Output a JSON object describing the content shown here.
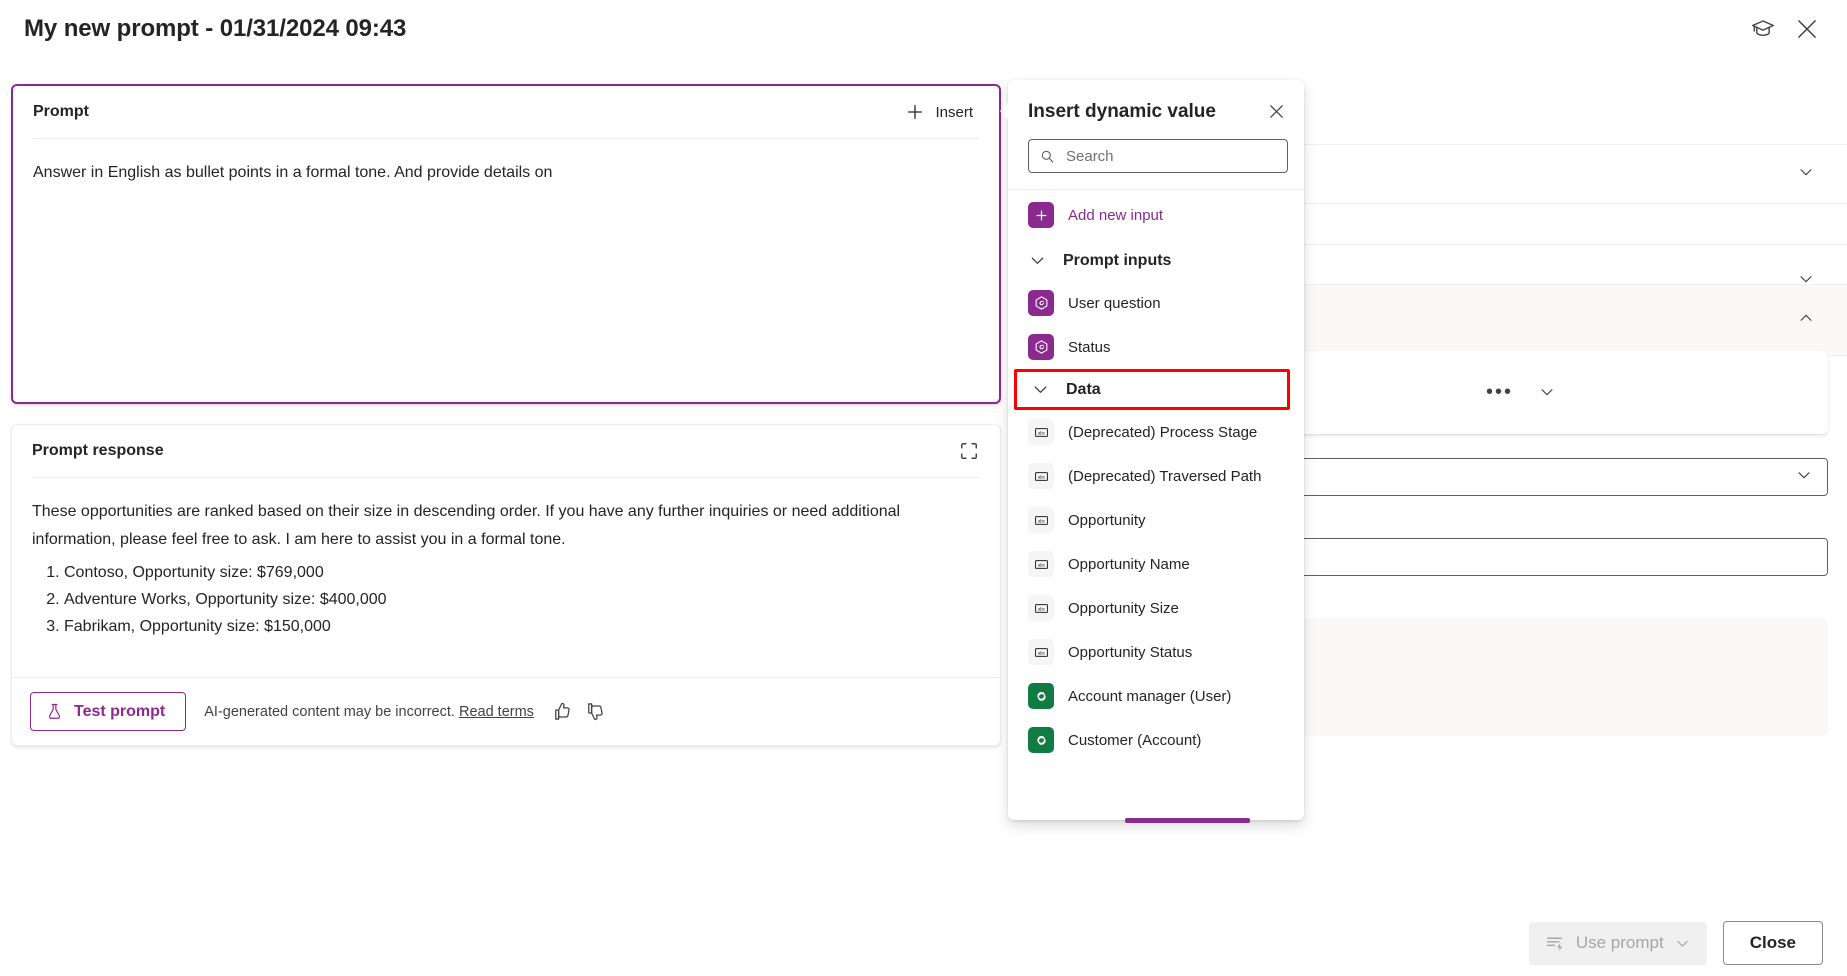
{
  "titlebar": {
    "title": "My new prompt - 01/31/2024 09:43",
    "learn_icon": "graduation-cap-icon",
    "close_icon": "close-icon"
  },
  "prompt_card": {
    "label": "Prompt",
    "insert_label": "Insert",
    "insert_icon": "plus-icon",
    "text": "Answer in English as bullet points in a formal tone. And provide details on"
  },
  "response_card": {
    "label": "Prompt response",
    "expand_icon": "fullscreen-icon",
    "paragraph": "These opportunities are ranked based on their size in descending order. If you have any further inquiries or need additional information, please feel free to ask. I am here to assist you in a formal tone.",
    "items": [
      "Contoso, Opportunity size: $769,000",
      "Adventure Works, Opportunity size: $400,000",
      "Fabrikam, Opportunity size: $150,000"
    ],
    "test_button": "Test prompt",
    "test_icon": "beaker-icon",
    "disclaimer": "AI-generated content may be incorrect.",
    "read_terms": "Read terms",
    "thumbs_up_icon": "thumbs-up-icon",
    "thumbs_down_icon": "thumbs-down-icon"
  },
  "flyout": {
    "title": "Insert dynamic value",
    "close_icon": "close-icon",
    "search": {
      "placeholder": "Search",
      "value": "",
      "icon": "search-icon"
    },
    "add_new_input": {
      "label": "Add new input",
      "icon": "plus-icon"
    },
    "groups": [
      {
        "label": "Prompt inputs",
        "chevron": "chevron-down-icon",
        "highlighted": false,
        "items": [
          {
            "label": "User question",
            "icon": "copilot-hexagon-icon",
            "icon_kind": "purple"
          },
          {
            "label": "Status",
            "icon": "copilot-hexagon-icon",
            "icon_kind": "purple"
          }
        ]
      },
      {
        "label": "Data",
        "chevron": "chevron-down-icon",
        "highlighted": true,
        "highlight_color": "#FF0000",
        "items": [
          {
            "label": "(Deprecated) Process Stage",
            "icon": "abc-textfield-icon",
            "icon_kind": "abc"
          },
          {
            "label": "(Deprecated) Traversed Path",
            "icon": "abc-textfield-icon",
            "icon_kind": "abc"
          },
          {
            "label": "Opportunity",
            "icon": "abc-textfield-icon",
            "icon_kind": "abc"
          },
          {
            "label": "Opportunity Name",
            "icon": "abc-textfield-icon",
            "icon_kind": "abc"
          },
          {
            "label": "Opportunity Size",
            "icon": "abc-textfield-icon",
            "icon_kind": "abc"
          },
          {
            "label": "Opportunity Status",
            "icon": "abc-textfield-icon",
            "icon_kind": "abc"
          },
          {
            "label": "Account manager (User)",
            "icon": "dataverse-icon",
            "icon_kind": "green"
          },
          {
            "label": "Customer (Account)",
            "icon": "dataverse-icon",
            "icon_kind": "green"
          }
        ]
      }
    ]
  },
  "bottombar": {
    "use_prompt": "Use prompt",
    "use_prompt_icon": "insert-lines-lightning-icon",
    "use_prompt_chevron": "chevron-down-icon",
    "use_prompt_disabled": true,
    "close": "Close"
  },
  "background_panel": {
    "sections": [
      {
        "chevron": "chevron-down-icon"
      },
      {
        "chevron": "chevron-down-icon"
      },
      {
        "chevron": "chevron-up-icon"
      }
    ],
    "more_options_icon": "ellipsis-icon",
    "card_chevron": "chevron-down-icon",
    "combobox_chevron": "chevron-down-icon"
  },
  "colors": {
    "accent": "#8A2A8F",
    "highlight": "#FF0000",
    "dataverse_green": "#107C41",
    "text": "#242424"
  }
}
